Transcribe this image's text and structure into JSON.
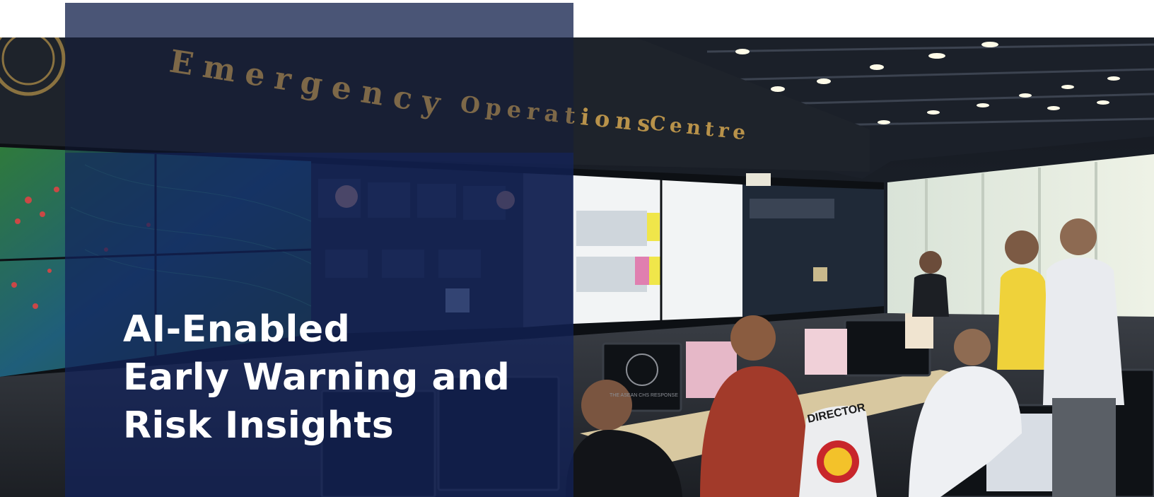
{
  "hero": {
    "headline_lines": [
      "AI-Enabled",
      "Early Warning and",
      "Risk Insights"
    ],
    "photo_sign": {
      "word1": "Emergency",
      "word2": "Operations",
      "word3": "Centre"
    },
    "jacket_text": "DIRECTOR",
    "monitor_text": "THE ASEAN CHS RESPONSE"
  },
  "colors": {
    "top_bar": "#4a5576",
    "overlay": "#12225c",
    "headline": "#ffffff",
    "sign": "#b8924a"
  }
}
